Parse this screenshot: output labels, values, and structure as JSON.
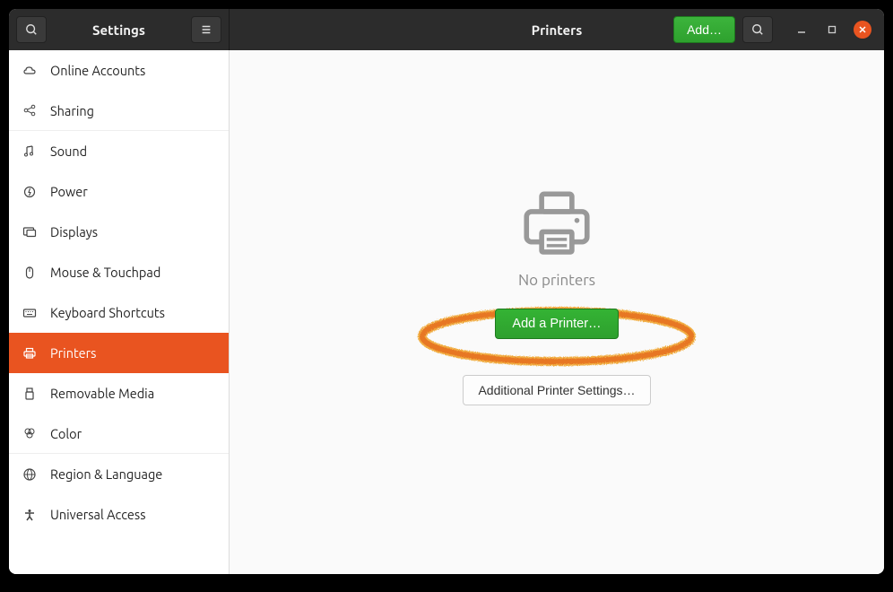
{
  "header": {
    "left_title": "Settings",
    "right_title": "Printers",
    "add_button": "Add…"
  },
  "sidebar": {
    "items": [
      {
        "label": "Online Accounts",
        "icon": "cloud-icon"
      },
      {
        "label": "Sharing",
        "icon": "share-icon"
      },
      {
        "label": "Sound",
        "icon": "music-icon"
      },
      {
        "label": "Power",
        "icon": "power-icon"
      },
      {
        "label": "Displays",
        "icon": "displays-icon"
      },
      {
        "label": "Mouse & Touchpad",
        "icon": "mouse-icon"
      },
      {
        "label": "Keyboard Shortcuts",
        "icon": "keyboard-icon"
      },
      {
        "label": "Printers",
        "icon": "printer-icon",
        "active": true
      },
      {
        "label": "Removable Media",
        "icon": "usb-icon"
      },
      {
        "label": "Color",
        "icon": "color-icon"
      },
      {
        "label": "Region & Language",
        "icon": "globe-icon"
      },
      {
        "label": "Universal Access",
        "icon": "accessibility-icon"
      }
    ]
  },
  "main": {
    "empty_state": "No printers",
    "add_printer": "Add a Printer…",
    "additional_settings": "Additional Printer Settings…"
  },
  "colors": {
    "accent": "#e95420",
    "success": "#2ea02e"
  },
  "annotation": {
    "type": "hand-drawn-ellipse",
    "target": "add-printer-button"
  }
}
